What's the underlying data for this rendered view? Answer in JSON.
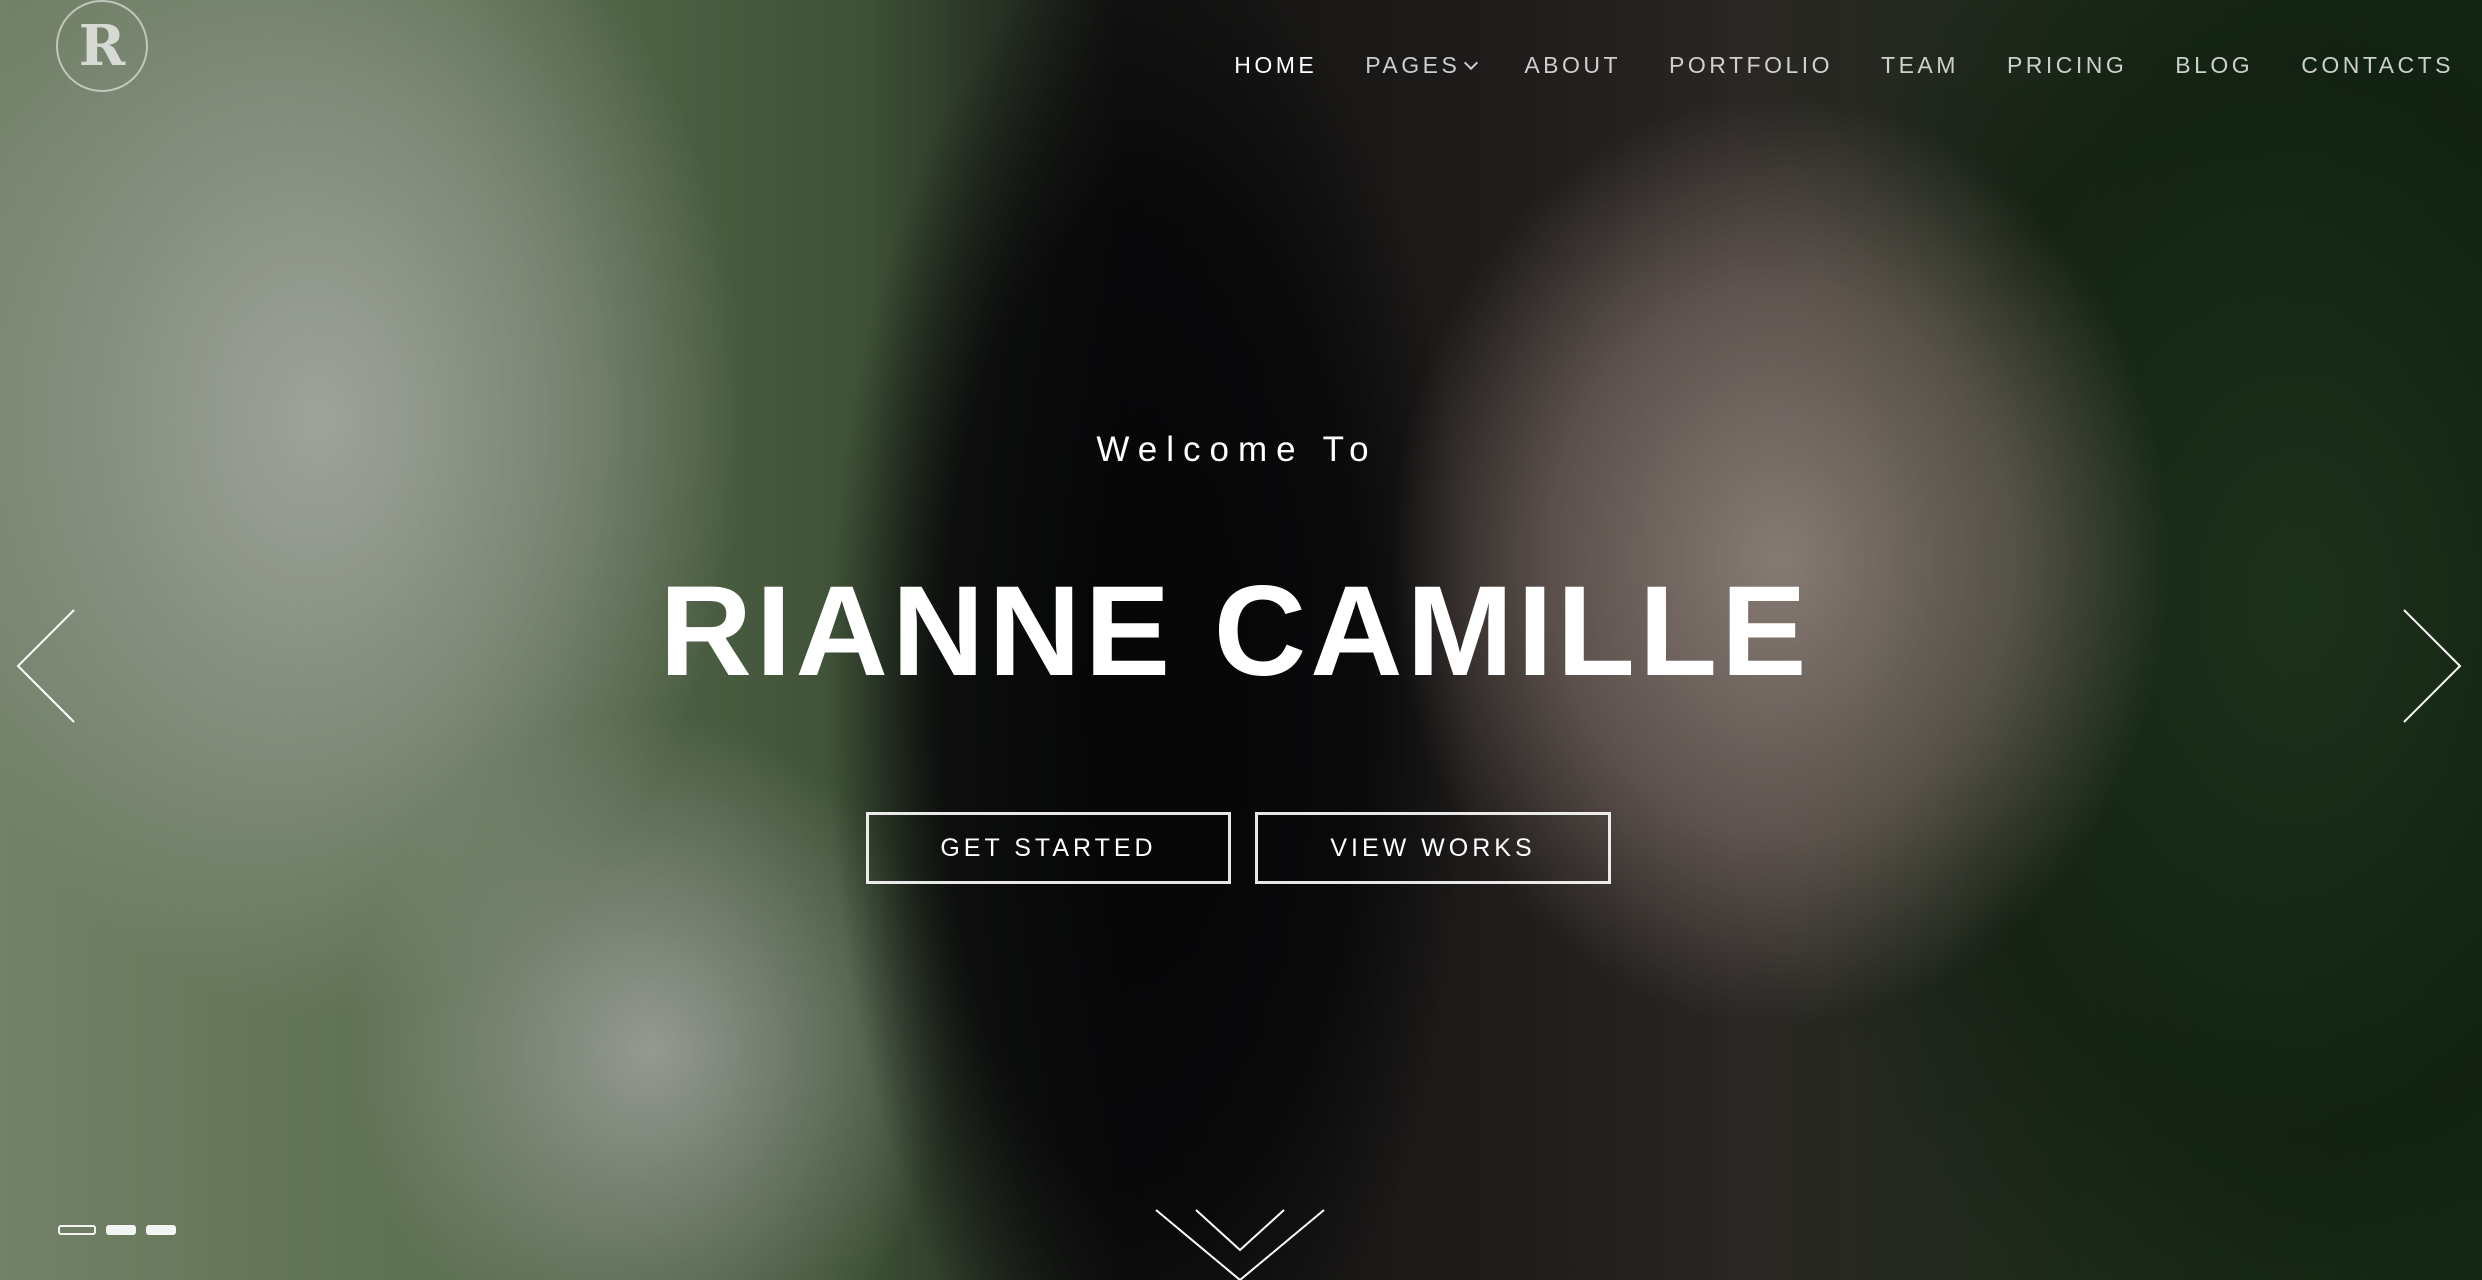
{
  "logo": {
    "letter": "R"
  },
  "nav": {
    "items": [
      {
        "label": "HOME",
        "active": true
      },
      {
        "label": "PAGES",
        "has_dropdown": true
      },
      {
        "label": "ABOUT"
      },
      {
        "label": "PORTFOLIO"
      },
      {
        "label": "TEAM"
      },
      {
        "label": "PRICING"
      },
      {
        "label": "BLOG"
      },
      {
        "label": "CONTACTS"
      }
    ]
  },
  "hero": {
    "welcome": "Welcome To",
    "title": "RIANNE CAMILLE",
    "buttons": {
      "get_started": "GET STARTED",
      "view_works": "VIEW WORKS"
    }
  },
  "slider": {
    "dot_count": 3,
    "active_index": 0
  },
  "icons": {
    "prev": "chevron-left-icon",
    "next": "chevron-right-icon",
    "scroll": "double-chevron-down-icon"
  }
}
